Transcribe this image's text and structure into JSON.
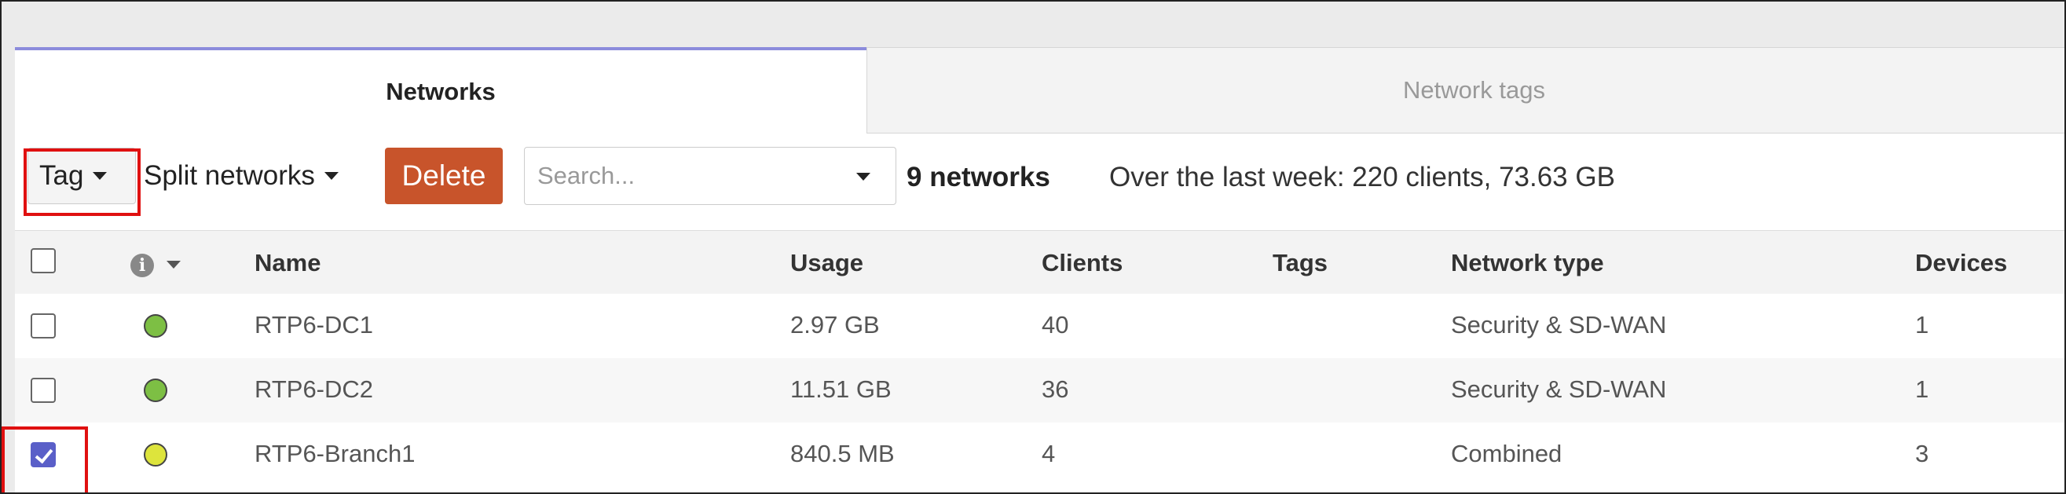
{
  "tabs": [
    {
      "label": "Networks",
      "active": true
    },
    {
      "label": "Network tags",
      "active": false
    }
  ],
  "toolbar": {
    "tag_label": "Tag",
    "split_label": "Split networks",
    "delete_label": "Delete",
    "search_placeholder": "Search...",
    "network_count": "9 networks",
    "summary": "Over the last week: 220 clients, 73.63 GB"
  },
  "table": {
    "headers": {
      "name": "Name",
      "usage": "Usage",
      "clients": "Clients",
      "tags": "Tags",
      "type": "Network type",
      "devices": "Devices"
    },
    "rows": [
      {
        "checked": false,
        "status": "green",
        "name": "RTP6-DC1",
        "usage": "2.97 GB",
        "clients": "40",
        "tags": "",
        "type": "Security & SD-WAN",
        "devices": "1"
      },
      {
        "checked": false,
        "status": "green",
        "name": "RTP6-DC2",
        "usage": "11.51 GB",
        "clients": "36",
        "tags": "",
        "type": "Security & SD-WAN",
        "devices": "1"
      },
      {
        "checked": true,
        "status": "yellow",
        "name": "RTP6-Branch1",
        "usage": "840.5 MB",
        "clients": "4",
        "tags": "",
        "type": "Combined",
        "devices": "3"
      }
    ]
  },
  "icons": {
    "info": "info-icon",
    "status_green": "#7dbf44",
    "status_yellow": "#dde43c",
    "accent": "#c8542b",
    "highlight": "#e01010"
  }
}
